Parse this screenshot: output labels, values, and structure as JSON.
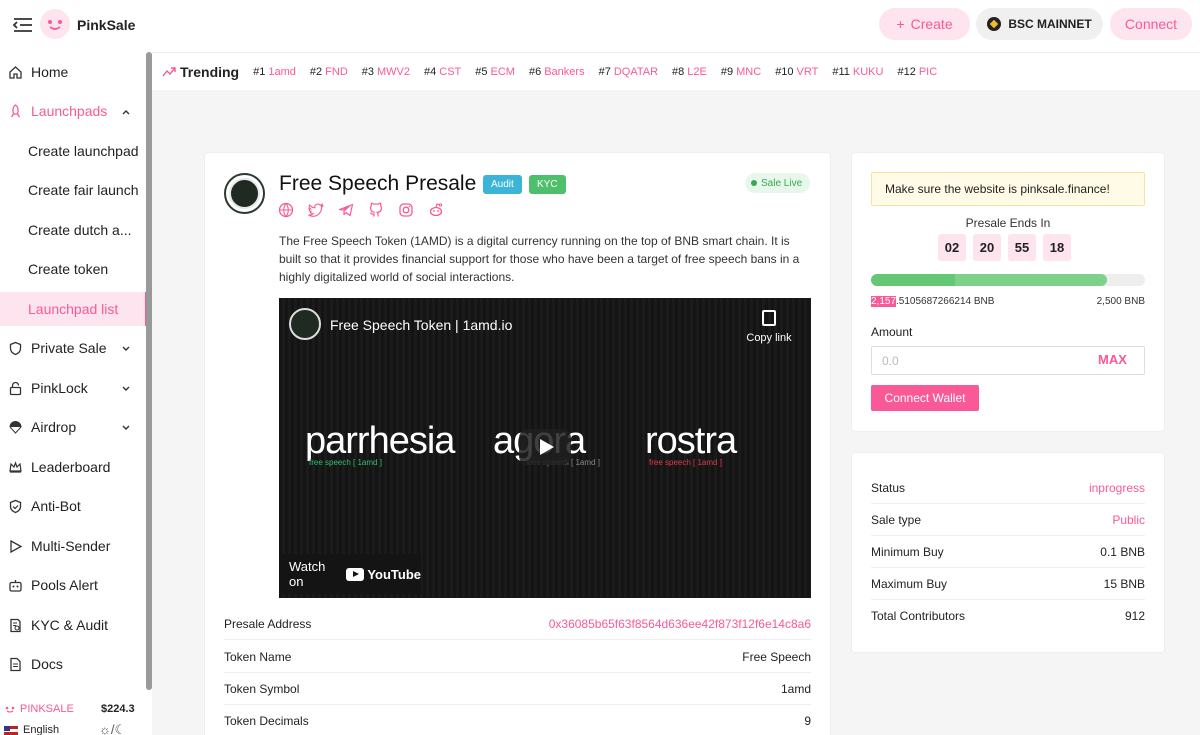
{
  "header": {
    "brand": "PinkSale",
    "create_label": "Create",
    "network_label": "BSC MAINNET",
    "connect_label": "Connect"
  },
  "sidebar": {
    "items": [
      {
        "label": "Home"
      },
      {
        "label": "Launchpads"
      },
      {
        "label": "Create launchpad"
      },
      {
        "label": "Create fair launch"
      },
      {
        "label": "Create dutch a..."
      },
      {
        "label": "Create token"
      },
      {
        "label": "Launchpad list"
      },
      {
        "label": "Private Sale"
      },
      {
        "label": "PinkLock"
      },
      {
        "label": "Airdrop"
      },
      {
        "label": "Leaderboard"
      },
      {
        "label": "Anti-Bot"
      },
      {
        "label": "Multi-Sender"
      },
      {
        "label": "Pools Alert"
      },
      {
        "label": "KYC & Audit"
      },
      {
        "label": "Docs"
      }
    ],
    "footer": {
      "token_name": "PINKSALE",
      "token_price": "$224.3",
      "language": "English"
    }
  },
  "trending": {
    "title": "Trending",
    "items": [
      {
        "rank": "#1",
        "name": "1amd"
      },
      {
        "rank": "#2",
        "name": "FND"
      },
      {
        "rank": "#3",
        "name": "MWV2"
      },
      {
        "rank": "#4",
        "name": "CST"
      },
      {
        "rank": "#5",
        "name": "ECM"
      },
      {
        "rank": "#6",
        "name": "Bankers"
      },
      {
        "rank": "#7",
        "name": "DQATAR"
      },
      {
        "rank": "#8",
        "name": "L2E"
      },
      {
        "rank": "#9",
        "name": "MNC"
      },
      {
        "rank": "#10",
        "name": "VRT"
      },
      {
        "rank": "#11",
        "name": "KUKU"
      },
      {
        "rank": "#12",
        "name": "PIC"
      }
    ]
  },
  "presale": {
    "title": "Free Speech Presale",
    "tag_audit": "Audit",
    "tag_kyc": "KYC",
    "status_badge": "Sale Live",
    "description": "The Free Speech Token (1AMD) is a digital currency running on the top of BNB smart chain. It is built so that it provides financial support for those who have been a target of free speech bans in a highly digitalized world of social interactions.",
    "video": {
      "title": "Free Speech Token | 1amd.io",
      "copy_link": "Copy link",
      "watch_on": "Watch on",
      "youtube": "YouTube",
      "logo_1": "parrhesia",
      "logo_1_sub": "free speech [ 1amd ]",
      "logo_2": "agora",
      "logo_2_sub": "free speech [ 1amd ]",
      "logo_3": "rostra",
      "logo_3_sub": "free speech [ 1amd ]"
    },
    "info": [
      {
        "label": "Presale Address",
        "value": "0x36085b65f63f8564d636ee42f873f12f6e14c8a6"
      },
      {
        "label": "Token Name",
        "value": "Free Speech"
      },
      {
        "label": "Token Symbol",
        "value": "1amd"
      },
      {
        "label": "Token Decimals",
        "value": "9"
      }
    ]
  },
  "buy_panel": {
    "warning": "Make sure the website is pinksale.finance!",
    "ends_label": "Presale Ends In",
    "countdown": [
      "02",
      "20",
      "55",
      "18"
    ],
    "progress_fraction": 0.863,
    "raised_highlight": "2,157",
    "raised_rest": ".5105687266214 BNB",
    "hardcap": "2,500 BNB",
    "amount_label": "Amount",
    "amount_placeholder": "0.0",
    "max_label": "MAX",
    "wallet_button": "Connect Wallet"
  },
  "stats": [
    {
      "label": "Status",
      "value": "inprogress"
    },
    {
      "label": "Sale type",
      "value": "Public"
    },
    {
      "label": "Minimum Buy",
      "value": "0.1 BNB"
    },
    {
      "label": "Maximum Buy",
      "value": "15 BNB"
    },
    {
      "label": "Total Contributors",
      "value": "912"
    }
  ],
  "colors": {
    "accent": "#f95997",
    "accent_soft": "#fde4ee",
    "success": "#36a850"
  }
}
